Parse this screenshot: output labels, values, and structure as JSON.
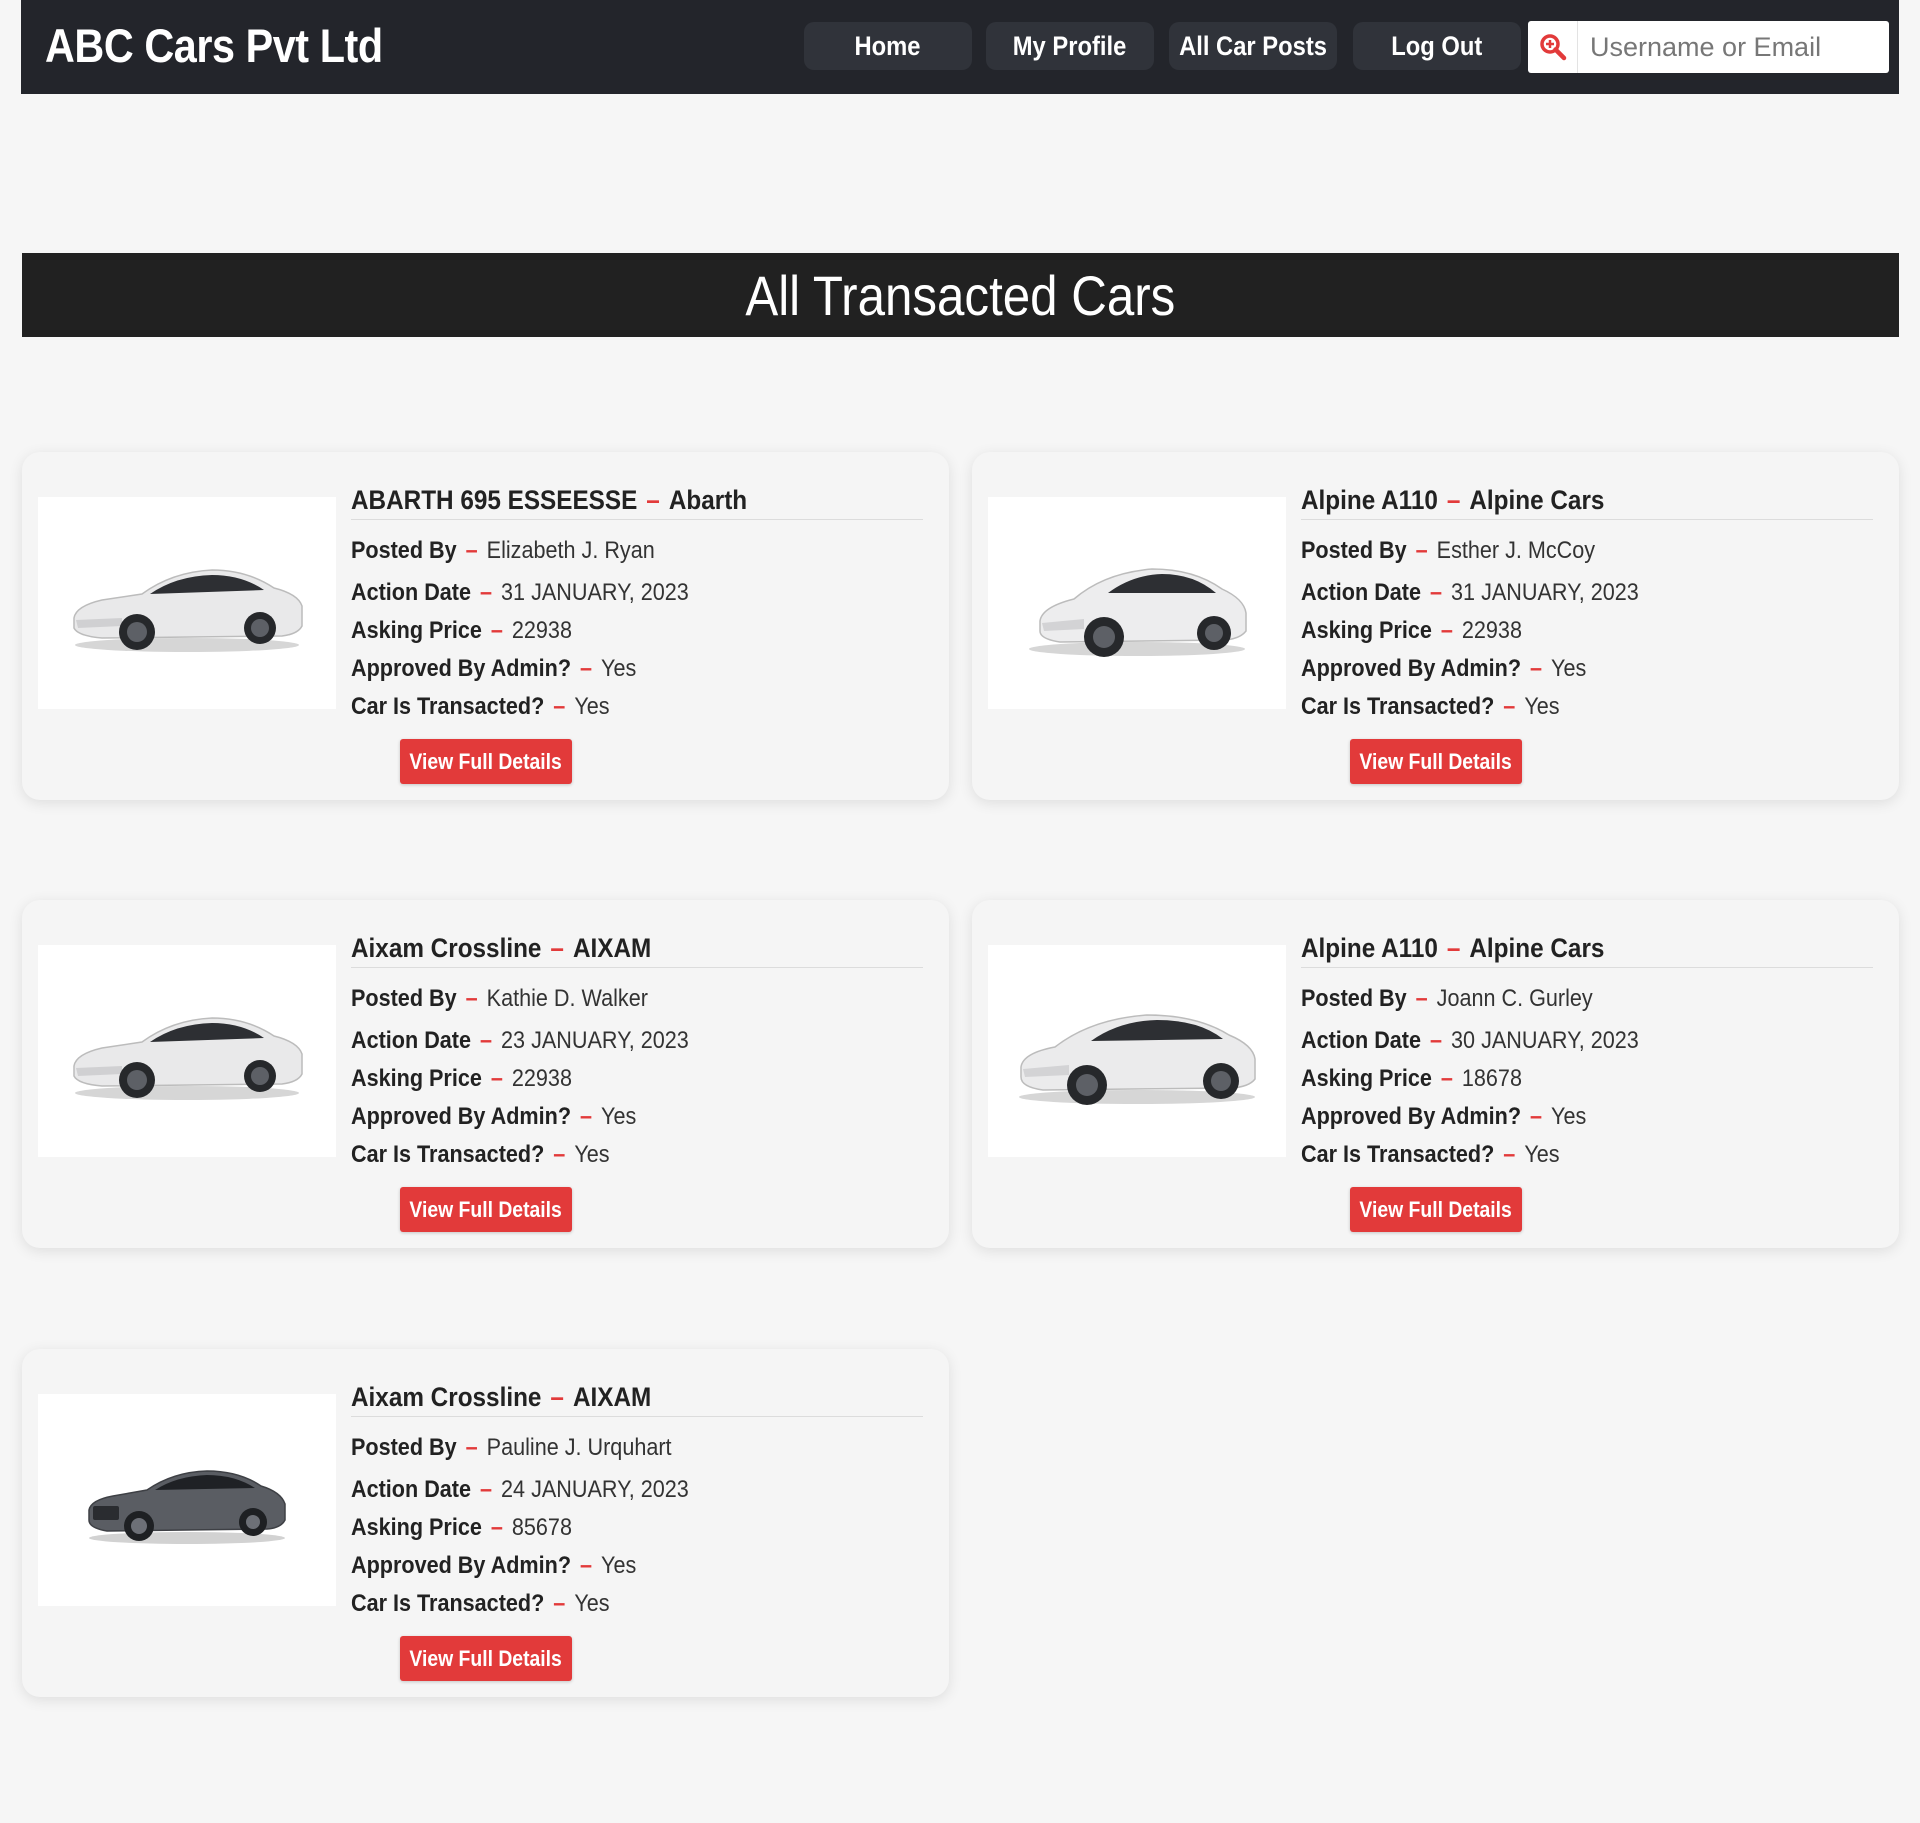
{
  "header": {
    "brand": "ABC Cars Pvt Ltd",
    "nav": {
      "home": "Home",
      "profile": "My Profile",
      "posts": "All Car Posts",
      "logout": "Log Out"
    },
    "search": {
      "placeholder": "Username or Email",
      "icon": "search-icon"
    }
  },
  "page_title": "All Transacted Cars",
  "labels": {
    "posted_by": "Posted By",
    "action_date": "Action Date",
    "asking_price": "Asking Price",
    "approved": "Approved By Admin?",
    "transacted": "Car Is Transacted?",
    "details_button": "View Full Details"
  },
  "colors": {
    "accent": "#e23a3a",
    "nav_bg": "#23252b",
    "banner_bg": "#212121"
  },
  "cars": [
    {
      "model": "ABARTH 695 ESSEESSE",
      "make": "Abarth",
      "posted_by": "Elizabeth J. Ryan",
      "action_date": "31 JANUARY, 2023",
      "asking_price": "22938",
      "approved": "Yes",
      "transacted": "Yes",
      "image": "white-sedan"
    },
    {
      "model": "Alpine A110",
      "make": "Alpine Cars",
      "posted_by": "Esther J. McCoy",
      "action_date": "31 JANUARY, 2023",
      "asking_price": "22938",
      "approved": "Yes",
      "transacted": "Yes",
      "image": "white-crossover"
    },
    {
      "model": "Aixam Crossline",
      "make": "AIXAM",
      "posted_by": "Kathie D. Walker",
      "action_date": "23 JANUARY, 2023",
      "asking_price": "22938",
      "approved": "Yes",
      "transacted": "Yes",
      "image": "white-sedan"
    },
    {
      "model": "Alpine A110",
      "make": "Alpine Cars",
      "posted_by": "Joann C. Gurley",
      "action_date": "30 JANUARY, 2023",
      "asking_price": "18678",
      "approved": "Yes",
      "transacted": "Yes",
      "image": "white-suv"
    },
    {
      "model": "Aixam Crossline",
      "make": "AIXAM",
      "posted_by": "Pauline J. Urquhart",
      "action_date": "24 JANUARY, 2023",
      "asking_price": "85678",
      "approved": "Yes",
      "transacted": "Yes",
      "image": "grey-sedan"
    }
  ]
}
